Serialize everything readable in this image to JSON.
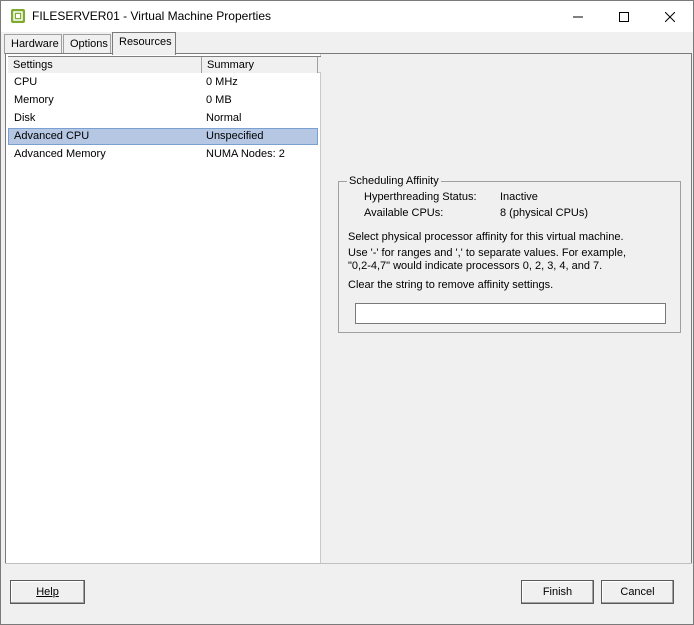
{
  "window": {
    "title": "FILESERVER01 - Virtual Machine Properties",
    "icons": {
      "app": "vm-icon",
      "minimize": "minimize-icon",
      "maximize": "maximize-icon",
      "close": "close-icon"
    }
  },
  "tabs": [
    {
      "label": "Hardware"
    },
    {
      "label": "Options"
    },
    {
      "label": "Resources",
      "active": true
    }
  ],
  "list": {
    "headers": [
      "Settings",
      "Summary"
    ],
    "rows": [
      {
        "setting": "CPU",
        "summary": "0 MHz"
      },
      {
        "setting": "Memory",
        "summary": "0 MB"
      },
      {
        "setting": "Disk",
        "summary": "Normal"
      },
      {
        "setting": "Advanced CPU",
        "summary": "Unspecified",
        "selected": true
      },
      {
        "setting": "Advanced Memory",
        "summary": "NUMA Nodes: 2"
      }
    ]
  },
  "affinity": {
    "group_label": "Scheduling Affinity",
    "hyperthreading_label": "Hyperthreading Status:",
    "hyperthreading_value": "Inactive",
    "cpus_label": "Available CPUs:",
    "cpus_value": "8 (physical CPUs)",
    "instruction_1": "Select physical processor affinity for this virtual machine.",
    "instruction_2": "Use '-' for ranges and ',' to separate values. For example,",
    "instruction_3": "\"0,2-4,7\" would indicate processors 0, 2, 3, 4, and 7.",
    "instruction_4": "Clear the string to remove affinity settings.",
    "input_value": ""
  },
  "buttons": {
    "help": "Help",
    "finish": "Finish",
    "cancel": "Cancel"
  },
  "colors": {
    "selection": "#b5c7e3",
    "window_bg": "#f0f0f0",
    "icon_green": "#7cab2e"
  }
}
